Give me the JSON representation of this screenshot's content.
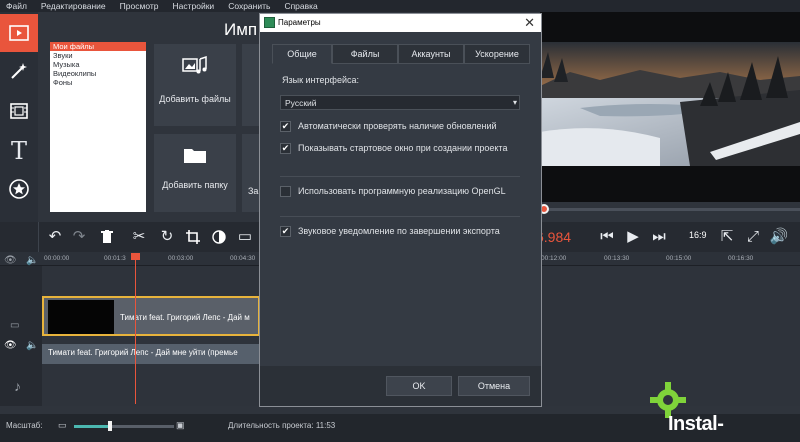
{
  "menu": [
    "Файл",
    "Редактирование",
    "Просмотр",
    "Настройки",
    "Сохранить",
    "Справка"
  ],
  "sidebar_tools": [
    "import-icon",
    "magic-wand-icon",
    "film-icon",
    "text-icon",
    "star-icon",
    "list-icon"
  ],
  "import": {
    "title": "Имп",
    "categories": [
      "Мои файлы",
      "Звуки",
      "Музыка",
      "Видеоклипы",
      "Фоны"
    ],
    "add_files": "Добавить файлы",
    "add_folder": "Добавить папку",
    "partial_tile_label": "За"
  },
  "time_display": "6.984",
  "aspect_ratio": "16:9",
  "ruler": [
    "00:00:00",
    "00:01:3",
    "00:03:00",
    "00:04:30",
    "00:12:00",
    "00:13:30",
    "00:15:00",
    "00:16:30"
  ],
  "timeline": {
    "video_clip_title": "Тимати feat. Григорий Лепс - Дай м",
    "audio_clip_title": "Тимати feat. Григорий Лепс - Дай мне уйти (премье"
  },
  "status": {
    "scale_label": "Масштаб:",
    "zoom_level": 0.36,
    "duration_label": "Длительность проекта:",
    "duration_value": "11:53"
  },
  "watermark": "Instal-program",
  "dialog": {
    "title": "Параметры",
    "tabs": [
      "Общие",
      "Файлы",
      "Аккаунты",
      "Ускорение"
    ],
    "active_tab": "Общие",
    "language_label": "Язык интерфейса:",
    "language_value": "Русский",
    "options": [
      {
        "label": "Автоматически проверять наличие обновлений",
        "checked": true
      },
      {
        "label": "Показывать стартовое окно при создании проекта",
        "checked": true
      },
      {
        "label": "Использовать программную реализацию OpenGL",
        "checked": false
      },
      {
        "label": "Звуковое уведомление по завершении экспорта",
        "checked": true
      }
    ],
    "ok": "OK",
    "cancel": "Отмена"
  },
  "colors": {
    "accent": "#e9553c",
    "watermark_gear": "#7fd33a",
    "zoom_fill": "#4bb7b0"
  }
}
